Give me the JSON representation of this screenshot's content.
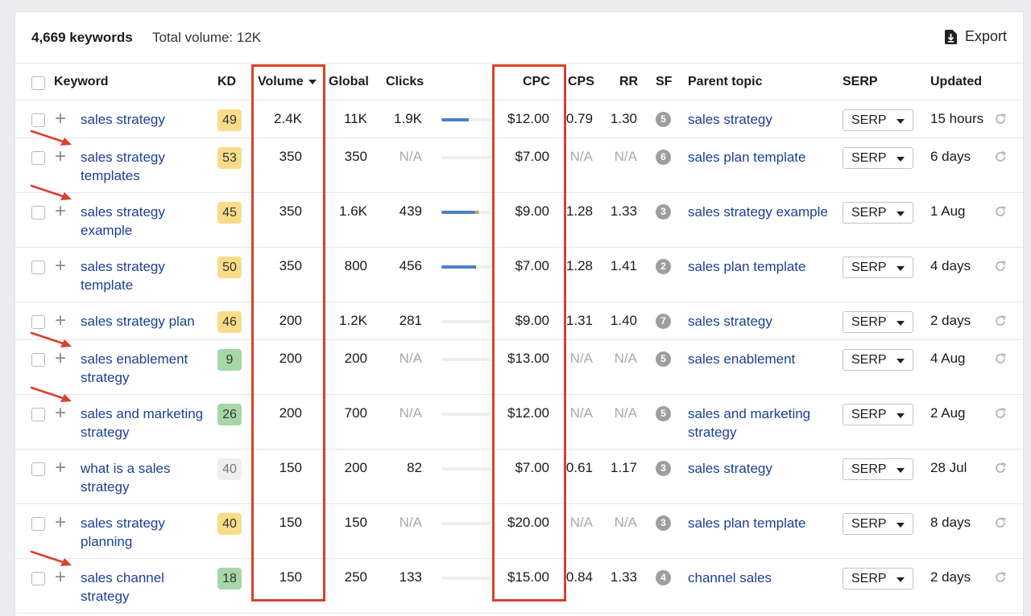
{
  "summary": {
    "count_label": "4,669 keywords",
    "total_label": "Total volume: 12K",
    "export_label": "Export"
  },
  "columns": {
    "keyword": "Keyword",
    "kd": "KD",
    "volume": "Volume",
    "global": "Global",
    "clicks": "Clicks",
    "cpc": "CPC",
    "cps": "CPS",
    "rr": "RR",
    "sf": "SF",
    "parent": "Parent topic",
    "serp": "SERP",
    "updated": "Updated"
  },
  "colors": {
    "kd_yellow": "#f9dc8a",
    "kd_green": "#a7d7a9",
    "kd_grey": "#eeeeee",
    "link": "#1c3f94",
    "highlight": "#d9412c",
    "bar_blue": "#4a80c8",
    "bar_orange": "#f0a040",
    "bar_purple": "#7a5fa0"
  },
  "rows": [
    {
      "keyword": "sales strategy",
      "kd": "49",
      "kd_color": "yellow",
      "volume": "2.4K",
      "global": "11K",
      "clicks": "1.9K",
      "clicks_na": false,
      "bar": [
        0.55,
        0,
        0
      ],
      "cpc": "$12.00",
      "cps": "0.79",
      "rr": "1.30",
      "sf": "5",
      "parent": "sales strategy",
      "serp": "SERP",
      "updated": "15 hours",
      "arrow": false
    },
    {
      "keyword": "sales strategy templates",
      "kd": "53",
      "kd_color": "yellow",
      "volume": "350",
      "global": "350",
      "clicks": "N/A",
      "clicks_na": true,
      "bar": [
        0,
        0,
        0
      ],
      "cpc": "$7.00",
      "cps": "N/A",
      "rr": "N/A",
      "sf": "6",
      "parent": "sales plan template",
      "serp": "SERP",
      "updated": "6 days",
      "arrow": true
    },
    {
      "keyword": "sales strategy example",
      "kd": "45",
      "kd_color": "yellow",
      "volume": "350",
      "global": "1.6K",
      "clicks": "439",
      "clicks_na": false,
      "bar": [
        0.68,
        0.05,
        0.02
      ],
      "cpc": "$9.00",
      "cps": "1.28",
      "rr": "1.33",
      "sf": "3",
      "parent": "sales strategy example",
      "serp": "SERP",
      "updated": "1 Aug",
      "arrow": true
    },
    {
      "keyword": "sales strategy template",
      "kd": "50",
      "kd_color": "yellow",
      "volume": "350",
      "global": "800",
      "clicks": "456",
      "clicks_na": false,
      "bar": [
        0.66,
        0,
        0.04
      ],
      "cpc": "$7.00",
      "cps": "1.28",
      "rr": "1.41",
      "sf": "2",
      "parent": "sales plan template",
      "serp": "SERP",
      "updated": "4 days",
      "arrow": false
    },
    {
      "keyword": "sales strategy plan",
      "kd": "46",
      "kd_color": "yellow",
      "volume": "200",
      "global": "1.2K",
      "clicks": "281",
      "clicks_na": false,
      "bar": [
        0,
        0,
        0
      ],
      "cpc": "$9.00",
      "cps": "1.31",
      "rr": "1.40",
      "sf": "7",
      "parent": "sales strategy",
      "serp": "SERP",
      "updated": "2 days",
      "arrow": false
    },
    {
      "keyword": "sales enablement strategy",
      "kd": "9",
      "kd_color": "green",
      "volume": "200",
      "global": "200",
      "clicks": "N/A",
      "clicks_na": true,
      "bar": [
        0,
        0,
        0
      ],
      "cpc": "$13.00",
      "cps": "N/A",
      "rr": "N/A",
      "sf": "5",
      "parent": "sales enablement",
      "serp": "SERP",
      "updated": "4 Aug",
      "arrow": true
    },
    {
      "keyword": "sales and marketing strategy",
      "kd": "26",
      "kd_color": "green",
      "volume": "200",
      "global": "700",
      "clicks": "N/A",
      "clicks_na": true,
      "bar": [
        0,
        0,
        0
      ],
      "cpc": "$12.00",
      "cps": "N/A",
      "rr": "N/A",
      "sf": "5",
      "parent": "sales and marketing strategy",
      "serp": "SERP",
      "updated": "2 Aug",
      "arrow": true
    },
    {
      "keyword": "what is a sales strategy",
      "kd": "40",
      "kd_color": "grey",
      "volume": "150",
      "global": "200",
      "clicks": "82",
      "clicks_na": false,
      "bar": [
        0,
        0,
        0
      ],
      "cpc": "$7.00",
      "cps": "0.61",
      "rr": "1.17",
      "sf": "3",
      "parent": "sales strategy",
      "serp": "SERP",
      "updated": "28 Jul",
      "arrow": false
    },
    {
      "keyword": "sales strategy planning",
      "kd": "40",
      "kd_color": "yellow",
      "volume": "150",
      "global": "150",
      "clicks": "N/A",
      "clicks_na": true,
      "bar": [
        0,
        0,
        0
      ],
      "cpc": "$20.00",
      "cps": "N/A",
      "rr": "N/A",
      "sf": "3",
      "parent": "sales plan template",
      "serp": "SERP",
      "updated": "8 days",
      "arrow": false
    },
    {
      "keyword": "sales channel strategy",
      "kd": "18",
      "kd_color": "green",
      "volume": "150",
      "global": "250",
      "clicks": "133",
      "clicks_na": false,
      "bar": [
        0,
        0,
        0
      ],
      "cpc": "$15.00",
      "cps": "0.84",
      "rr": "1.33",
      "sf": "4",
      "parent": "channel sales",
      "serp": "SERP",
      "updated": "2 days",
      "arrow": true
    }
  ]
}
